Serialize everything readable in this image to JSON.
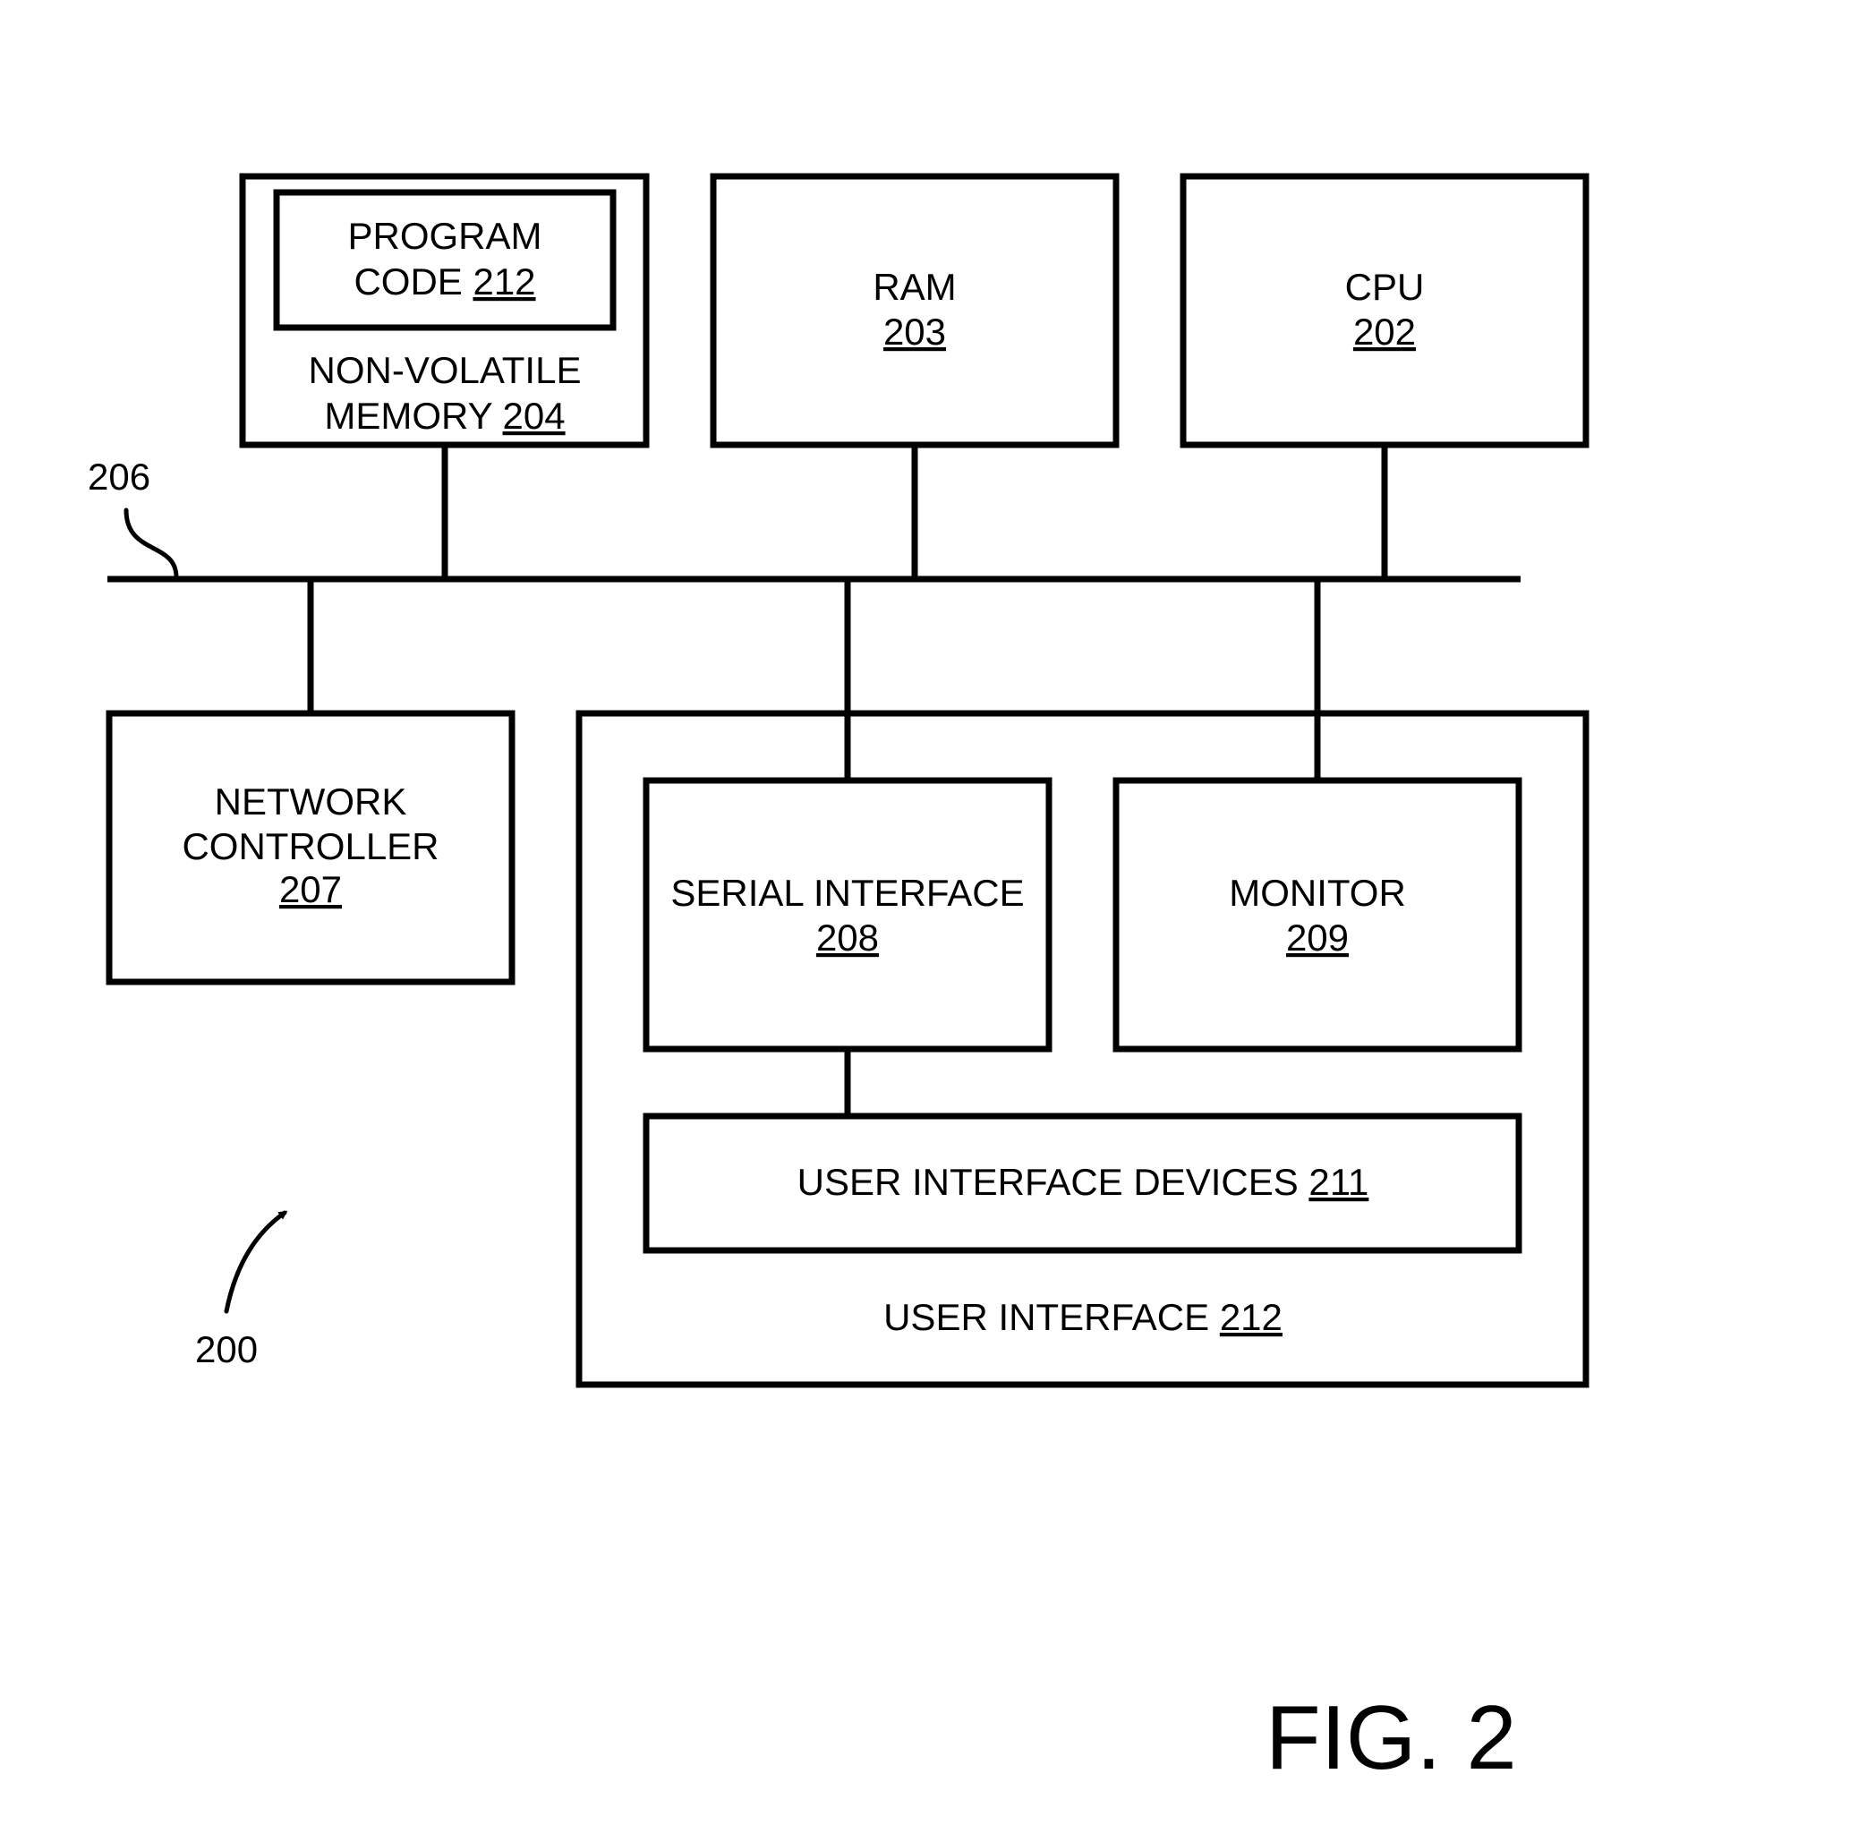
{
  "figure": {
    "title": "FIG. 2",
    "system_ref": "200",
    "bus_ref": "206"
  },
  "blocks": {
    "program_code": {
      "lines": [
        "PROGRAM"
      ],
      "name": "CODE",
      "ref": "212"
    },
    "nvm": {
      "lines": [
        "NON-VOLATILE"
      ],
      "name": "MEMORY",
      "ref": "204"
    },
    "ram": {
      "name": "RAM",
      "ref": "203"
    },
    "cpu": {
      "name": "CPU",
      "ref": "202"
    },
    "network_controller": {
      "lines": [
        "NETWORK",
        "CONTROLLER"
      ],
      "ref": "207"
    },
    "serial_interface": {
      "name": "SERIAL INTERFACE",
      "ref": "208"
    },
    "monitor": {
      "name": "MONITOR",
      "ref": "209"
    },
    "ui_devices": {
      "name": "USER INTERFACE DEVICES",
      "ref": "211"
    },
    "user_interface": {
      "name": "USER INTERFACE",
      "ref": "212"
    }
  },
  "colors": {
    "ink": "#000000",
    "background": "#ffffff"
  }
}
